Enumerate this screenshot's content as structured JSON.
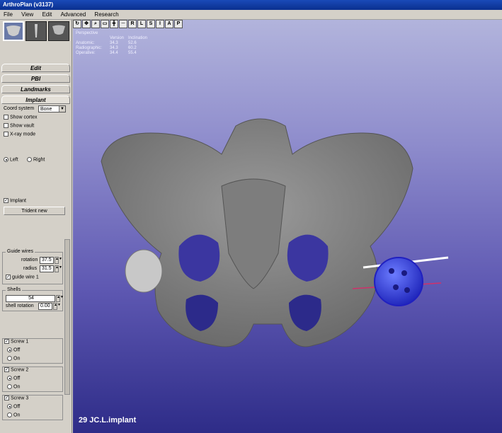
{
  "window": {
    "title": "ArthroPlan (v3137)"
  },
  "menu": [
    "File",
    "View",
    "Edit",
    "Advanced",
    "Research"
  ],
  "thumbnails": [
    "pelvis-thumbnail",
    "femur-thumbnail",
    "pelvis-alt-thumbnail"
  ],
  "tabs": [
    "Edit",
    "PBI",
    "Landmarks",
    "Implant"
  ],
  "implant_panel": {
    "coord_label": "Coord system",
    "coord_value": "Bone",
    "show_cortex": "Show cortex",
    "show_vault": "Show vault",
    "xray_mode": "X-ray mode",
    "side_left": "Left",
    "side_right": "Right",
    "implant_label": "Implant",
    "trident_button": "Trident new",
    "guide_wires_title": "Guide wires",
    "rotation_label": "rotation",
    "rotation_value": "37.5",
    "radius_label": "radius",
    "radius_value": "31.5",
    "guide_wire_1": "guide wire 1",
    "shells_title": "Shells",
    "shell_size": "54",
    "shell_rotation_label": "shell rotation",
    "shell_rotation_value": "0.00",
    "screws": [
      {
        "title": "Screw 1",
        "off": "Off",
        "on": "On"
      },
      {
        "title": "Screw 2",
        "off": "Off",
        "on": "On"
      },
      {
        "title": "Screw 3",
        "off": "Off",
        "on": "On"
      }
    ]
  },
  "viewport": {
    "toolbar_letters": [
      "R",
      "L",
      "S",
      "I",
      "A",
      "P"
    ],
    "view_mode": "Perspective",
    "table_headers": [
      "Version",
      "Inclination"
    ],
    "table_rows": [
      {
        "label": "Anatomic:",
        "version": "34.3",
        "inclination": "52.6"
      },
      {
        "label": "Radiographic:",
        "version": "34.3",
        "inclination": "60.2"
      },
      {
        "label": "Operative:",
        "version": "34.4",
        "inclination": "55.4"
      }
    ],
    "caption": "29 JC.L.implant"
  }
}
